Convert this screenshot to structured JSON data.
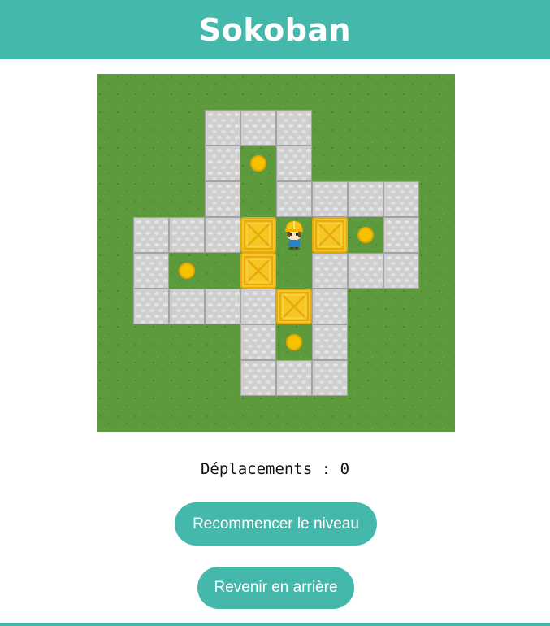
{
  "header": {
    "title": "Sokoban"
  },
  "colors": {
    "accent": "#44b8ab",
    "grass": "#5d9a3c",
    "wall": "#cfcfcf",
    "box": "#f6c623",
    "goal": "#f6c200"
  },
  "board": {
    "grid_size": 10,
    "walls": [
      [
        3,
        1
      ],
      [
        4,
        1
      ],
      [
        5,
        1
      ],
      [
        3,
        2
      ],
      [
        5,
        2
      ],
      [
        3,
        3
      ],
      [
        5,
        3
      ],
      [
        6,
        3
      ],
      [
        7,
        3
      ],
      [
        8,
        3
      ],
      [
        1,
        4
      ],
      [
        2,
        4
      ],
      [
        3,
        4
      ],
      [
        8,
        4
      ],
      [
        1,
        5
      ],
      [
        6,
        5
      ],
      [
        7,
        5
      ],
      [
        8,
        5
      ],
      [
        1,
        6
      ],
      [
        2,
        6
      ],
      [
        3,
        6
      ],
      [
        4,
        6
      ],
      [
        6,
        6
      ],
      [
        4,
        7
      ],
      [
        6,
        7
      ],
      [
        4,
        8
      ],
      [
        5,
        8
      ],
      [
        6,
        8
      ]
    ],
    "boxes": [
      [
        4,
        4
      ],
      [
        6,
        4
      ],
      [
        4,
        5
      ],
      [
        5,
        6
      ]
    ],
    "goals": [
      [
        4,
        2
      ],
      [
        7,
        4
      ],
      [
        2,
        5
      ],
      [
        5,
        7
      ]
    ],
    "player": [
      5,
      4
    ],
    "icons": {
      "wall": "stone-brick-icon",
      "box": "crate-icon",
      "goal": "target-dot-icon",
      "player": "worker-icon"
    }
  },
  "status": {
    "moves_text": "Déplacements : 0",
    "moves": 0
  },
  "buttons": {
    "restart_label": "Recommencer le niveau",
    "undo_label": "Revenir en arrière"
  }
}
